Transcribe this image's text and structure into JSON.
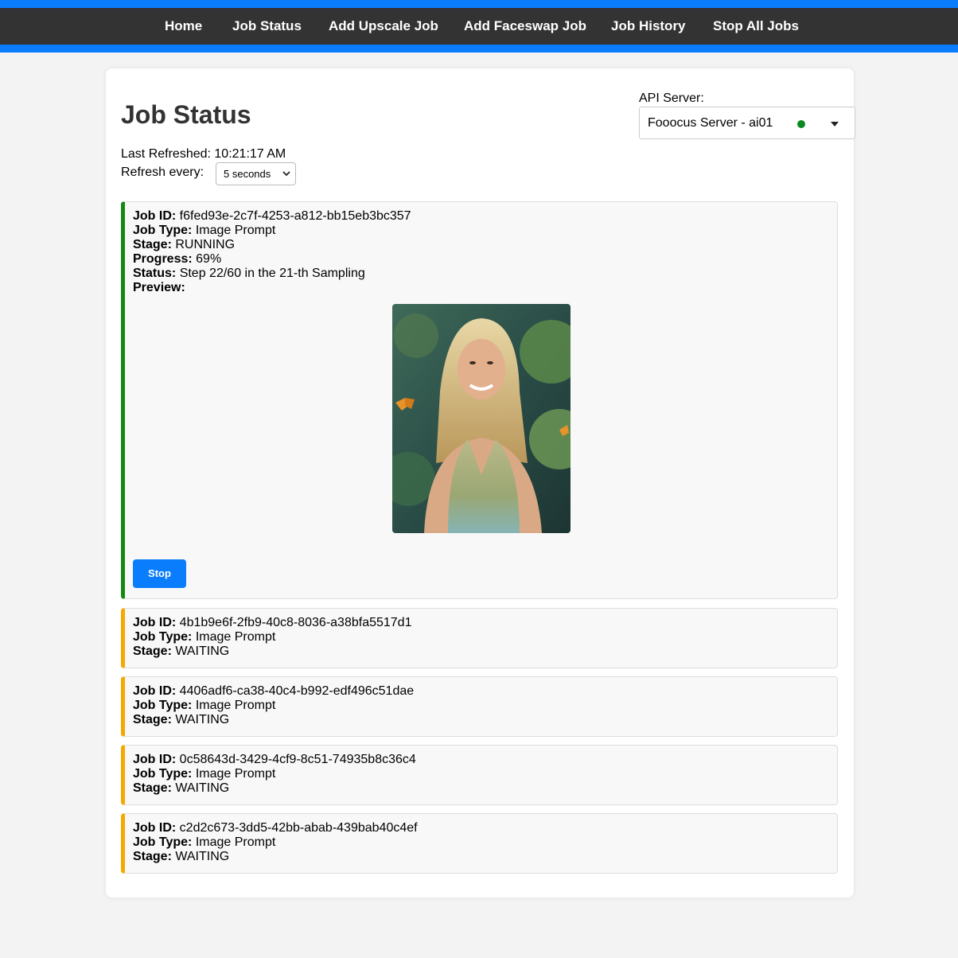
{
  "nav": {
    "items": [
      {
        "label": "Home"
      },
      {
        "label": "Job Status"
      },
      {
        "label": "Add Upscale Job"
      },
      {
        "label": "Add Faceswap Job"
      },
      {
        "label": "Job History"
      },
      {
        "label": "Stop All Jobs"
      }
    ]
  },
  "page": {
    "title": "Job Status",
    "last_refreshed_label": "Last Refreshed:",
    "last_refreshed_value": "10:21:17 AM",
    "refresh_label": "Refresh every:",
    "refresh_value": "5 seconds"
  },
  "api": {
    "label": "API Server:",
    "selected": "Fooocus Server - ai01",
    "status_color": "#0a8a1e"
  },
  "labels": {
    "job_id": "Job ID:",
    "job_type": "Job Type:",
    "stage": "Stage:",
    "progress": "Progress:",
    "status": "Status:",
    "preview": "Preview:"
  },
  "jobs": [
    {
      "id": "f6fed93e-2c7f-4253-a812-bb15eb3bc357",
      "type": "Image Prompt",
      "stage": "RUNNING",
      "progress": "69%",
      "status": "Step 22/60 in the 21-th Sampling",
      "stop_label": "Stop"
    },
    {
      "id": "4b1b9e6f-2fb9-40c8-8036-a38bfa5517d1",
      "type": "Image Prompt",
      "stage": "WAITING"
    },
    {
      "id": "4406adf6-ca38-40c4-b992-edf496c51dae",
      "type": "Image Prompt",
      "stage": "WAITING"
    },
    {
      "id": "0c58643d-3429-4cf9-8c51-74935b8c36c4",
      "type": "Image Prompt",
      "stage": "WAITING"
    },
    {
      "id": "c2d2c673-3dd5-42bb-abab-439bab40c4ef",
      "type": "Image Prompt",
      "stage": "WAITING"
    }
  ],
  "colors": {
    "accent": "#0a7dfc",
    "nav_bg": "#333333",
    "running": "#138a12",
    "waiting": "#f6a800"
  }
}
